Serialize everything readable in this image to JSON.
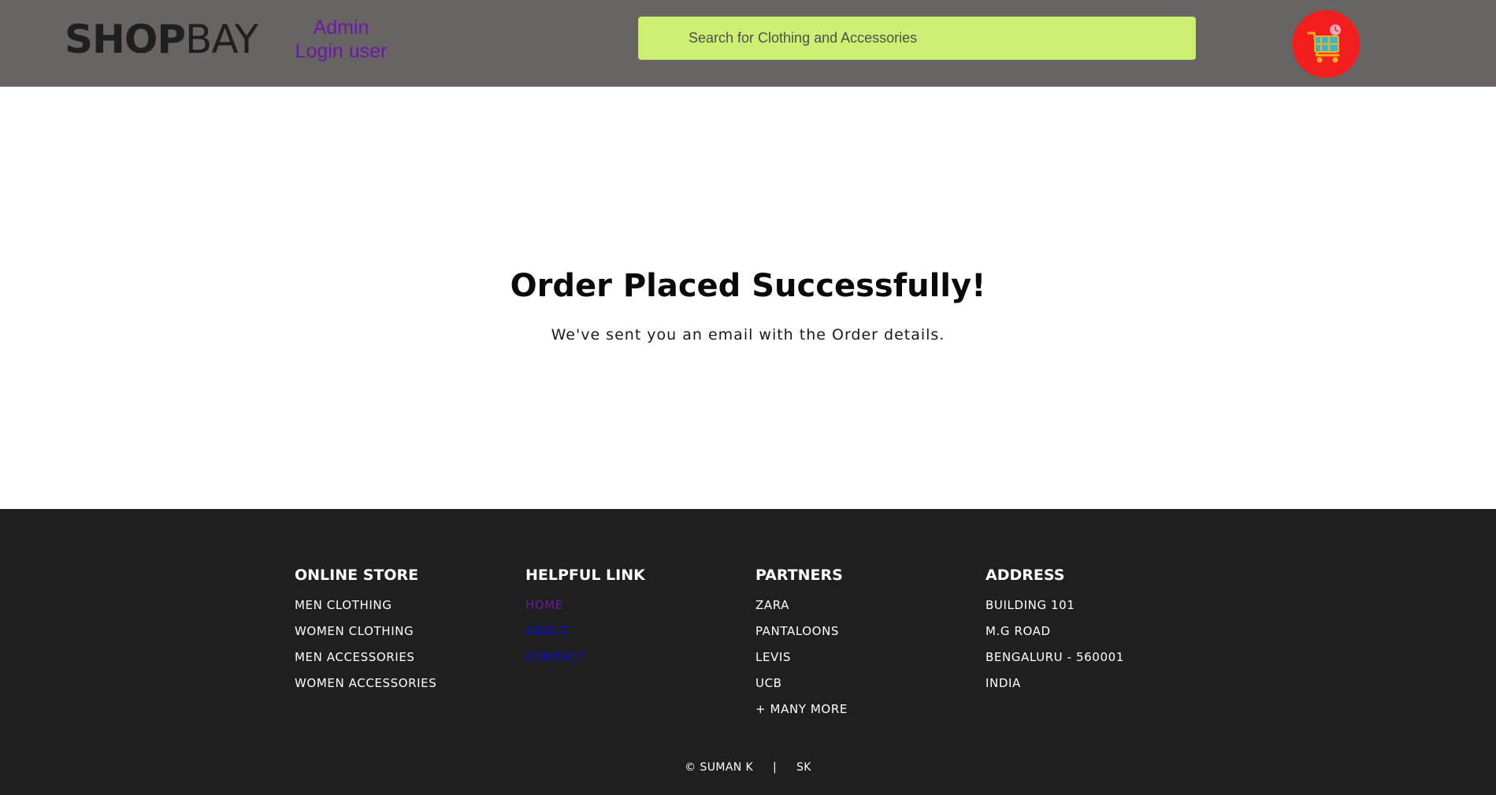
{
  "header": {
    "logo_bold": "SHOP",
    "logo_light": "BAY",
    "admin_line1": "Admin",
    "admin_line2": "Login user",
    "search_placeholder": "Search for Clothing and Accessories",
    "cart_icon": "shopping-cart-icon",
    "colors": {
      "background": "#686464",
      "search": "#cdef72",
      "cart": "#f21d1d",
      "admin_link": "#6a1aa0"
    }
  },
  "main": {
    "title": "Order Placed Successfully!",
    "message": "We've sent you an email with the Order details."
  },
  "footer": {
    "columns": [
      {
        "title": "ONLINE STORE",
        "items": [
          "MEN CLOTHING",
          "WOMEN CLOTHING",
          "MEN ACCESSORIES",
          "WOMEN ACCESSORIES"
        ]
      },
      {
        "title": "HELPFUL LINK",
        "items": [
          "HOME",
          "ABOUT",
          "CONTACT"
        ]
      },
      {
        "title": "PARTNERS",
        "items": [
          "ZARA",
          "PANTALOONS",
          "LEVIS",
          "UCB",
          "+ MANY MORE"
        ]
      },
      {
        "title": "ADDRESS",
        "items": [
          "BUILDING 101",
          "M.G ROAD",
          "BENGALURU - 560001",
          "INDIA"
        ]
      }
    ],
    "copyright": "© SUMAN K",
    "separator": "|",
    "signature": "SK",
    "colors": {
      "background": "#1f1f1f",
      "visited_link": "#6a1aa0",
      "link": "#0b0bd6"
    }
  }
}
